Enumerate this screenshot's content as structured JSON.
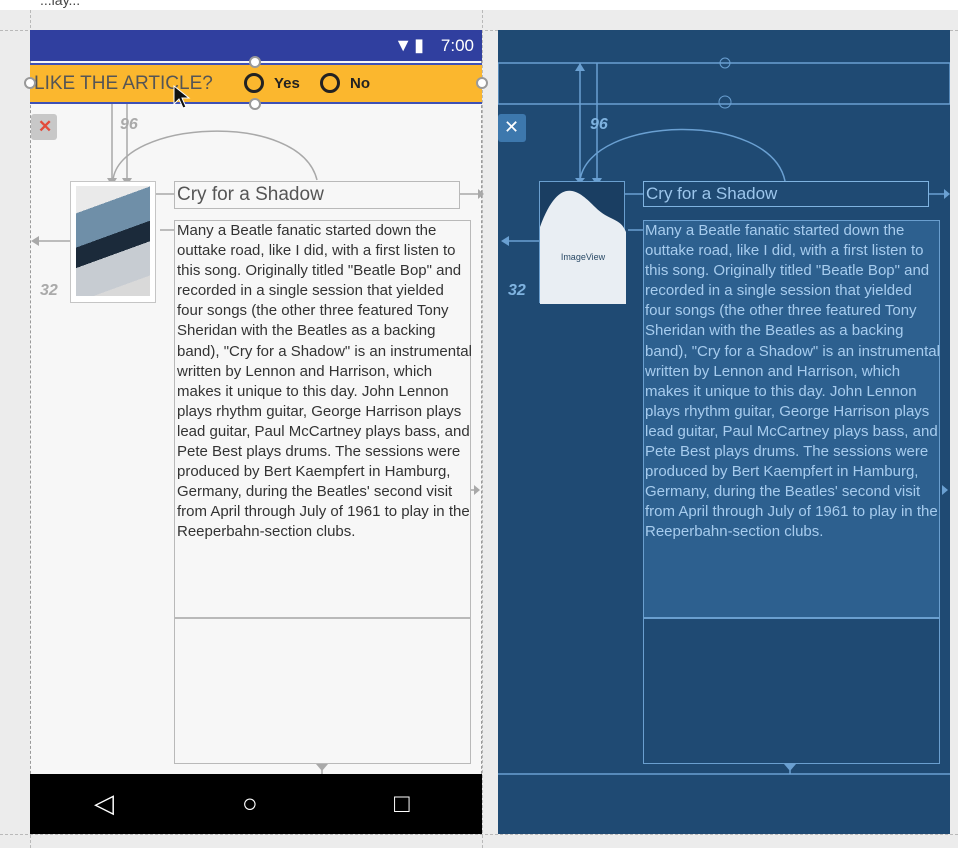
{
  "window": {
    "title_clip": "...lay..."
  },
  "design": {
    "status_bar": {
      "time": "7:00",
      "icons": "▼▮"
    },
    "banner": {
      "label": "LIKE THE ARTICLE?",
      "options": [
        "Yes",
        "No"
      ],
      "color": "#fbb72e"
    },
    "margins": {
      "top": "96",
      "left": "32"
    },
    "article": {
      "title": "Cry for a Shadow",
      "body": "Many a Beatle fanatic started down the outtake road, like I did, with a first listen to this song. Originally titled \"Beatle Bop\" and recorded in a single session that yielded four songs (the other three featured Tony Sheridan with the Beatles as a backing band), \"Cry for a Shadow\" is an instrumental written by Lennon and Harrison, which makes it unique to this day. John Lennon plays rhythm guitar, George Harrison plays lead guitar, Paul McCartney plays bass, and Pete Best plays drums. The sessions were produced by Bert Kaempfert in Hamburg, Germany, during the Beatles' second visit from April through July of 1961 to play in the Reeperbahn-section clubs."
    },
    "nav_bar": {
      "back": "◁",
      "home": "○",
      "recents": "□"
    },
    "delete_icon": "✕"
  },
  "blueprint": {
    "margins": {
      "top": "96",
      "left": "32"
    },
    "image_label": "ImageView",
    "delete_icon": "✕",
    "bg_color": "#1f4a73"
  }
}
